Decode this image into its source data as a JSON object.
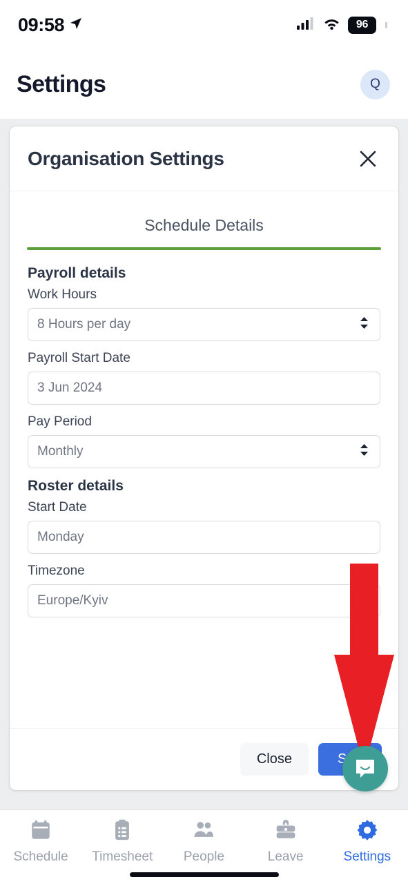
{
  "status_bar": {
    "time": "09:58",
    "location_icon": "location-arrow-icon",
    "cellular_icon": "cellular-signal-icon",
    "wifi_icon": "wifi-icon",
    "battery_level": "96"
  },
  "header": {
    "title": "Settings",
    "avatar_initial": "Q"
  },
  "modal": {
    "title": "Organisation Settings",
    "close_icon": "close-icon",
    "tab": {
      "label": "Schedule Details",
      "underline_color": "#5d9e3d"
    },
    "sections": [
      {
        "title": "Payroll details",
        "fields": [
          {
            "label": "Work Hours",
            "value": "8 Hours per day",
            "control": "select",
            "icon": "chevron-updown-icon"
          },
          {
            "label": "Payroll Start Date",
            "value": "3 Jun 2024",
            "control": "text",
            "icon": ""
          },
          {
            "label": "Pay Period",
            "value": "Monthly",
            "control": "select",
            "icon": "chevron-updown-icon"
          }
        ]
      },
      {
        "title": "Roster details",
        "fields": [
          {
            "label": "Start Date",
            "value": "Monday",
            "control": "select",
            "icon": ""
          },
          {
            "label": "Timezone",
            "value": "Europe/Kyiv",
            "control": "select",
            "icon": ""
          }
        ]
      }
    ],
    "footer": {
      "close_label": "Close",
      "save_label": "S",
      "save_color": "#3b6fe0"
    }
  },
  "annotation": {
    "arrow_icon": "red-down-arrow-icon",
    "arrow_color": "#e81f25"
  },
  "chat_widget": {
    "icon": "chat-bubble-icon",
    "color": "#3e9d94"
  },
  "bottom_nav": {
    "active_color": "#2f6be0",
    "inactive_color": "#9aa0ab",
    "items": [
      {
        "label": "Schedule",
        "icon": "calendar-icon",
        "active": false
      },
      {
        "label": "Timesheet",
        "icon": "clipboard-icon",
        "active": false
      },
      {
        "label": "People",
        "icon": "people-icon",
        "active": false
      },
      {
        "label": "Leave",
        "icon": "briefcase-icon",
        "active": false
      },
      {
        "label": "Settings",
        "icon": "gear-icon",
        "active": true
      }
    ]
  }
}
